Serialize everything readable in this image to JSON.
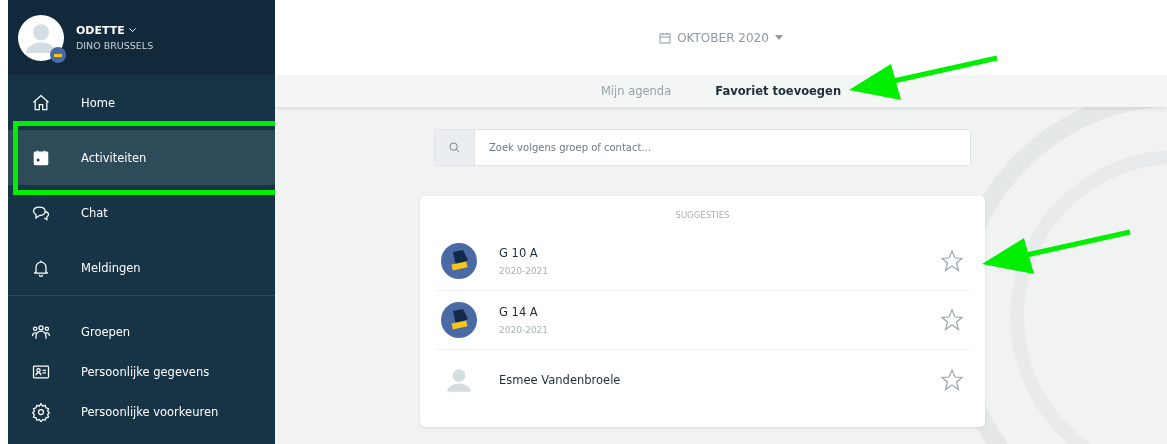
{
  "profile": {
    "name": "ODETTE",
    "organisation": "DINO BRUSSELS"
  },
  "sidebar": {
    "sections": [
      {
        "items": [
          {
            "label": "Home",
            "selected": false,
            "highlighted": false
          },
          {
            "label": "Activiteiten",
            "selected": true,
            "highlighted": true
          },
          {
            "label": "Chat",
            "selected": false,
            "highlighted": false
          },
          {
            "label": "Meldingen",
            "selected": false,
            "highlighted": false
          }
        ]
      },
      {
        "items": [
          {
            "label": "Groepen",
            "selected": false,
            "highlighted": false
          },
          {
            "label": "Persoonlijke gegevens",
            "selected": false,
            "highlighted": false
          },
          {
            "label": "Persoonlijke voorkeuren",
            "selected": false,
            "highlighted": false
          }
        ]
      }
    ]
  },
  "month": "OKTOBER 2020",
  "tabs": [
    {
      "label": "Mijn agenda",
      "selected": false,
      "arrow": false
    },
    {
      "label": "Favoriet toevoegen",
      "selected": true,
      "arrow": true
    }
  ],
  "search": {
    "placeholder": "Zoek volgens groep of contact..."
  },
  "suggestions": {
    "title": "SUGGESTIES",
    "items": [
      {
        "kind": "group",
        "name": "G 10 A",
        "subtitle": "2020-2021",
        "favorite": false,
        "arrow": true
      },
      {
        "kind": "group",
        "name": "G 14 A",
        "subtitle": "2020-2021",
        "favorite": false,
        "arrow": false
      },
      {
        "kind": "person",
        "name": "Esmee Vandenbroele",
        "favorite": false,
        "arrow": false
      }
    ]
  }
}
